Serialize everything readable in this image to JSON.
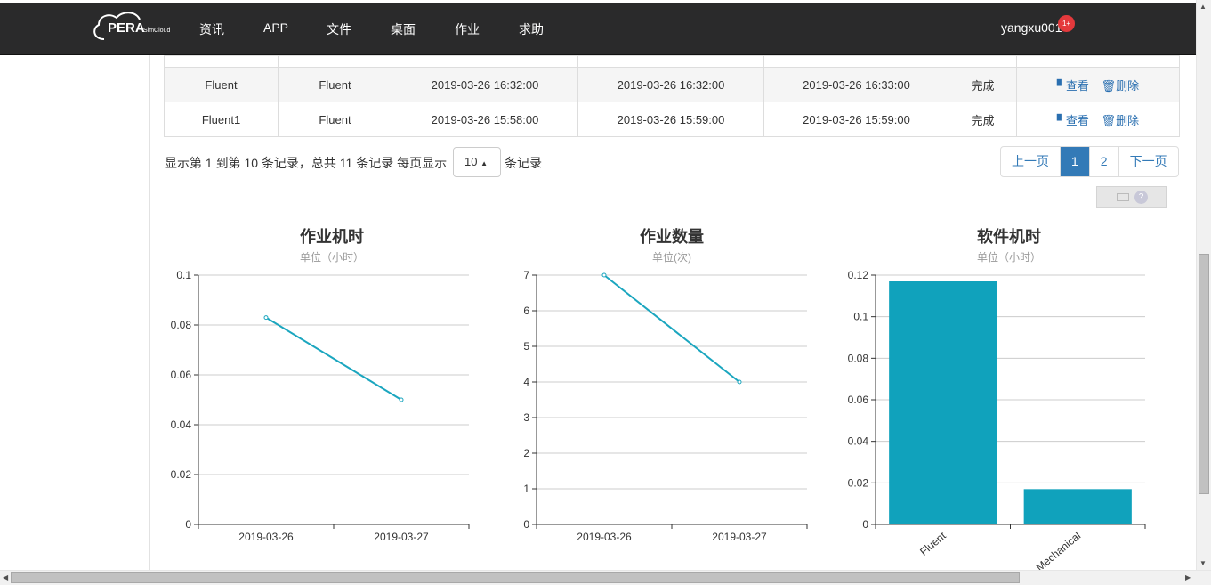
{
  "navbar": {
    "logo_text": "PERA",
    "logo_subtext": "SimCloud",
    "items": [
      "资讯",
      "APP",
      "文件",
      "桌面",
      "作业",
      "求助"
    ],
    "username": "yangxu001",
    "badge": "1+"
  },
  "table": {
    "rows": [
      {
        "name": "Fluent",
        "software": "Fluent",
        "submit": "2019-03-26 16:32:00",
        "start": "2019-03-26 16:32:00",
        "end": "2019-03-26 16:33:00",
        "status": "完成"
      },
      {
        "name": "Fluent1",
        "software": "Fluent",
        "submit": "2019-03-26 15:58:00",
        "start": "2019-03-26 15:59:00",
        "end": "2019-03-26 15:59:00",
        "status": "完成"
      }
    ],
    "view_label": "查看",
    "delete_label": "删除"
  },
  "pagination": {
    "info": "显示第 1 到第 10 条记录，总共 11 条记录 每页显示",
    "page_size": "10",
    "suffix": "条记录",
    "prev": "上一页",
    "pages": [
      "1",
      "2"
    ],
    "next": "下一页"
  },
  "charts": [
    {
      "title": "作业机时",
      "subtitle": "单位（小时）"
    },
    {
      "title": "作业数量",
      "subtitle": "单位(次)"
    },
    {
      "title": "软件机时",
      "subtitle": "单位（小时）"
    }
  ],
  "chart_data": [
    {
      "type": "line",
      "title": "作业机时",
      "subtitle": "单位（小时）",
      "categories": [
        "2019-03-26",
        "2019-03-27"
      ],
      "values": [
        0.083,
        0.05
      ],
      "ylim": [
        0,
        0.1
      ],
      "yticks": [
        "0",
        "0.02",
        "0.04",
        "0.06",
        "0.08",
        "0.1"
      ],
      "color": "#1ba6bf",
      "grid": true
    },
    {
      "type": "line",
      "title": "作业数量",
      "subtitle": "单位(次)",
      "categories": [
        "2019-03-26",
        "2019-03-27"
      ],
      "values": [
        7,
        4
      ],
      "ylim": [
        0,
        7
      ],
      "yticks": [
        "0",
        "1",
        "2",
        "3",
        "4",
        "5",
        "6",
        "7"
      ],
      "color": "#1ba6bf",
      "grid": true
    },
    {
      "type": "bar",
      "title": "软件机时",
      "subtitle": "单位（小时）",
      "categories": [
        "Fluent",
        "Mechanical"
      ],
      "values": [
        0.117,
        0.017
      ],
      "ylim": [
        0,
        0.12
      ],
      "yticks": [
        "0",
        "0.02",
        "0.04",
        "0.06",
        "0.08",
        "0.1",
        "0.12"
      ],
      "color": "#10a2bc",
      "grid": true
    }
  ]
}
